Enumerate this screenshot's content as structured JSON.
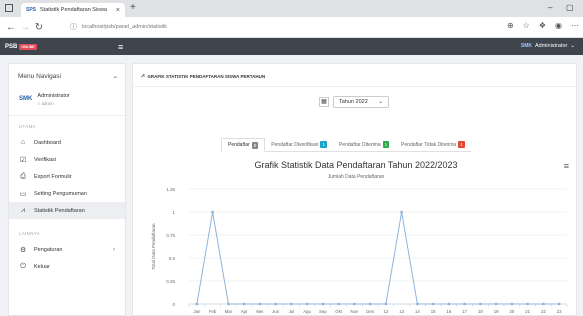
{
  "browser": {
    "tab_title": "Statistik Pendaftaran Siswa",
    "tab_favicon": "SPS",
    "url": "localhost/psb/panel_admin/statistik",
    "icons": [
      "back-icon",
      "forward-icon",
      "reload-icon",
      "info-icon",
      "star-icon",
      "extensions-icon",
      "profile-icon",
      "menu-icon"
    ]
  },
  "header": {
    "brand": "PSB",
    "brand_badge": "ONLINE",
    "user_logo": "SMK",
    "user_name": "Administrator"
  },
  "sidebar": {
    "title": "Menu Navigasi",
    "admin_logo": "SMK",
    "admin_name": "Administrator",
    "admin_role": "admin",
    "section_main": "UTAMA",
    "section_other": "LAINNYA",
    "items": [
      {
        "label": "Dashboard",
        "icon": "home-icon"
      },
      {
        "label": "Verifikasi",
        "icon": "check-icon"
      },
      {
        "label": "Export Formulir",
        "icon": "export-icon"
      },
      {
        "label": "Setting Pengumuman",
        "icon": "monitor-icon"
      },
      {
        "label": "Statistik Pendaftaran",
        "icon": "chart-icon"
      }
    ],
    "other_items": [
      {
        "label": "Pengaturan",
        "icon": "settings-icon"
      },
      {
        "label": "Keluar",
        "icon": "power-icon"
      }
    ]
  },
  "main": {
    "title": "GRAFIK STATISTIK PENDAFTARAN SISWA PERTAHUN",
    "year_select": "Tahun 2022",
    "tabs": [
      {
        "label": "Pendaftar",
        "badge": "0",
        "color": "#888888"
      },
      {
        "label": "Pendaftar Diverifikasi",
        "badge": "1",
        "color": "#1aa3c9"
      },
      {
        "label": "Pendaftar Diterima",
        "badge": "1",
        "color": "#2eaa4a"
      },
      {
        "label": "Pendaftar Tidak Diterima",
        "badge": "1",
        "color": "#e0482f"
      }
    ]
  },
  "chart_data": {
    "type": "line",
    "title": "Grafik Statistik Data Pendaftaran Tahun 2022/2023",
    "subtitle": "Jumlah Data Pendaftaran",
    "ylabel": "Total Data Pendaftaran",
    "xlabel": "",
    "ylim": [
      0,
      1.25
    ],
    "yticks": [
      "0",
      "0.25",
      "0.5",
      "0.75",
      "1",
      "1.25"
    ],
    "categories": [
      "Jan",
      "Feb",
      "Mar",
      "Apr",
      "Mei",
      "Jun",
      "Jul",
      "Agu",
      "Sep",
      "Okt",
      "Nov",
      "Des",
      "12",
      "13",
      "14",
      "15",
      "16",
      "17",
      "18",
      "19",
      "20",
      "21",
      "22",
      "23"
    ],
    "values": [
      0,
      1,
      0,
      0,
      0,
      0,
      0,
      0,
      0,
      0,
      0,
      0,
      0,
      1,
      0,
      0,
      0,
      0,
      0,
      0,
      0,
      0,
      0,
      0
    ],
    "color": "#8fb4dc",
    "grid": true
  }
}
